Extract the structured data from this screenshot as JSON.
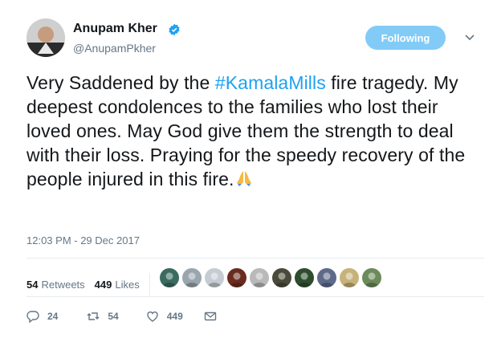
{
  "user": {
    "name": "Anupam Kher",
    "handle": "@AnupamPkher",
    "verified": true
  },
  "follow_button": {
    "label": "Following"
  },
  "tweet": {
    "text_before": "Very Saddened by the ",
    "hashtag": "#KamalaMills",
    "text_after": " fire tragedy. My deepest condolences to the families who lost their loved ones. May God give them the strength to deal with their loss. Praying for the speedy recovery of the people injured in this fire.",
    "emoji": "folded-hands",
    "timestamp": "12:03 PM - 29 Dec 2017"
  },
  "stats": {
    "retweets_count": "54",
    "retweets_label": "Retweets",
    "likes_count": "449",
    "likes_label": "Likes"
  },
  "likers": [
    {
      "color": "#3a6b5e"
    },
    {
      "color": "#9aa6ad"
    },
    {
      "color": "#c5ccd3"
    },
    {
      "color": "#6b2c20"
    },
    {
      "color": "#b9b9b9"
    },
    {
      "color": "#4a4a3a"
    },
    {
      "color": "#2d4d2e"
    },
    {
      "color": "#5f6a8a"
    },
    {
      "color": "#c7b27a"
    },
    {
      "color": "#6c8a5a"
    }
  ],
  "actions": {
    "reply_count": "24",
    "retweet_count": "54",
    "like_count": "449"
  },
  "colors": {
    "accent": "#1da1f2",
    "text": "#14171a",
    "muted": "#657786"
  }
}
